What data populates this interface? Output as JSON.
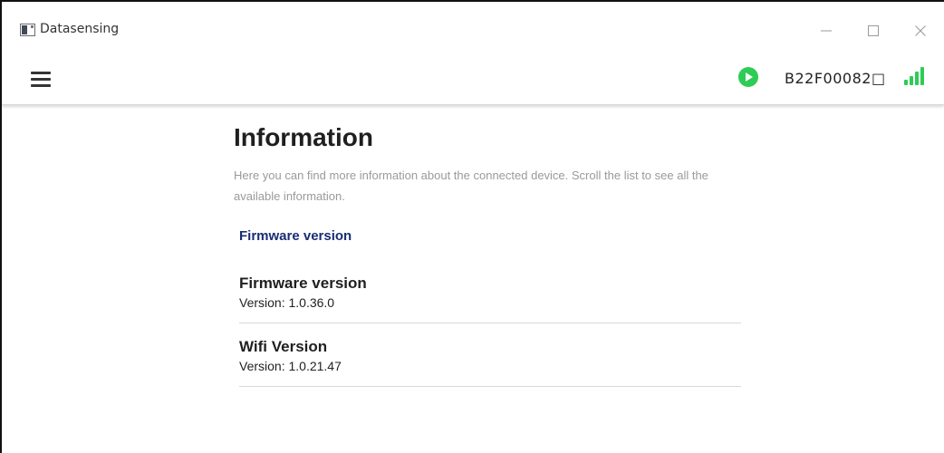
{
  "window": {
    "title": "Datasensing",
    "minimize_glyph": "—",
    "maximize_glyph": "☐",
    "close_glyph": "✕"
  },
  "toolbar": {
    "device_id": "B22F00082□",
    "status_color": "#2ecc55"
  },
  "page": {
    "title": "Information",
    "description": "Here you can find more information about the connected device. Scroll the list to see all the available information.",
    "section_header": "Firmware version",
    "items": [
      {
        "title": "Firmware version",
        "value": "Version: 1.0.36.0"
      },
      {
        "title": "Wifi Version",
        "value": "Version: 1.0.21.47"
      }
    ]
  },
  "colors": {
    "accent_green": "#2ecc55",
    "section_header": "#1a2d73"
  },
  "icons": {
    "menu": "hamburger-menu-icon",
    "play": "play-icon",
    "signal": "signal-strength-icon",
    "app": "app-icon"
  }
}
